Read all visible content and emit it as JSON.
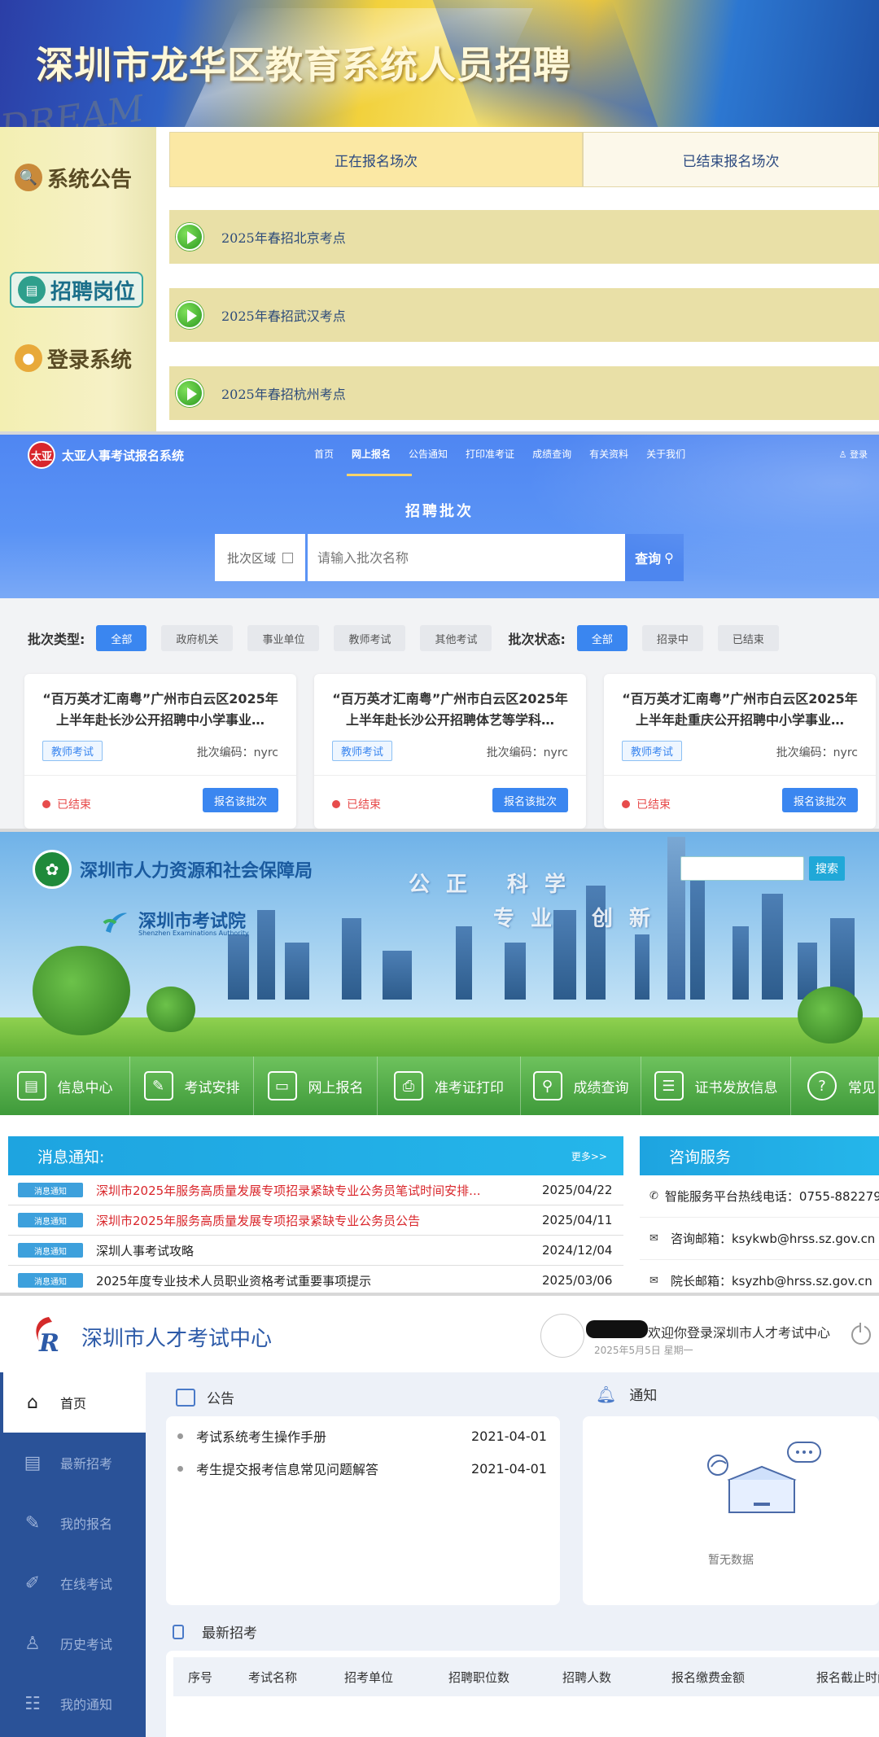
{
  "panel1": {
    "banner_title": "深圳市龙华区教育系统人员招聘",
    "watermark": "DREAM",
    "side": [
      {
        "label": "系统公告",
        "icon": "magnifier-icon"
      },
      {
        "label": "招聘岗位",
        "icon": "chat-icon"
      },
      {
        "label": "登录系统",
        "icon": "user-icon"
      }
    ],
    "tabs": {
      "active": "正在报名场次",
      "inactive": "已结束报名场次"
    },
    "sessions": [
      "2025年春招北京考点",
      "2025年春招武汉考点",
      "2025年春招杭州考点"
    ]
  },
  "panel2": {
    "logo_text": "太亚",
    "system_name": "太亚人事考试报名系统",
    "nav": [
      "首页",
      "网上报名",
      "公告通知",
      "打印准考证",
      "成绩查询",
      "有关资料",
      "关于我们"
    ],
    "nav_active": "网上报名",
    "login": "登录",
    "hero_title": "招聘批次",
    "zone_label": "批次区域",
    "search_placeholder": "请输入批次名称",
    "search_button": "查询",
    "type_label": "批次类型:",
    "types": [
      "全部",
      "政府机关",
      "事业单位",
      "教师考试",
      "其他考试"
    ],
    "status_label": "批次状态:",
    "statuses": [
      "全部",
      "招录中",
      "已结束"
    ],
    "cards": [
      {
        "title": "“百万英才汇南粤”广州市白云区2025年上半年赴长沙公开招聘中小学事业…",
        "tag": "教师考试",
        "code": "批次编码：nyrc",
        "status": "已结束",
        "button": "报名该批次"
      },
      {
        "title": "“百万英才汇南粤”广州市白云区2025年上半年赴长沙公开招聘体艺等学科…",
        "tag": "教师考试",
        "code": "批次编码：nyrc",
        "status": "已结束",
        "button": "报名该批次"
      },
      {
        "title": "“百万英才汇南粤”广州市白云区2025年上半年赴重庆公开招聘中小学事业…",
        "tag": "教师考试",
        "code": "批次编码：nyrc",
        "status": "已结束",
        "button": "报名该批次"
      }
    ]
  },
  "panel3": {
    "bureau": "深圳市人力资源和社会保障局",
    "exam_name": "深圳市考试院",
    "exam_en": "Shenzhen Examinations Authority",
    "slogan1": "公正 科学",
    "slogan2": "专业 创新",
    "search_button": "搜索",
    "menu": [
      {
        "label": "信息中心",
        "icon": "document-icon"
      },
      {
        "label": "考试安排",
        "icon": "pen-icon"
      },
      {
        "label": "网上报名",
        "icon": "monitor-icon"
      },
      {
        "label": "准考证打印",
        "icon": "printer-icon"
      },
      {
        "label": "成绩查询",
        "icon": "search-icon"
      },
      {
        "label": "证书发放信息",
        "icon": "list-icon"
      },
      {
        "label": "常见",
        "icon": "question-icon"
      }
    ],
    "notice_title": "消息通知:",
    "notice_more": "更多>>",
    "notices": [
      {
        "badge": "消息通知",
        "text": "深圳市2025年服务高质量发展专项招录紧缺专业公务员笔试时间安排...",
        "date": "2025/04/22",
        "red": true
      },
      {
        "badge": "消息通知",
        "text": "深圳市2025年服务高质量发展专项招录紧缺专业公务员公告",
        "date": "2025/04/11",
        "red": true
      },
      {
        "badge": "消息通知",
        "text": "深圳人事考试攻略",
        "date": "2024/12/04",
        "red": false
      },
      {
        "badge": "消息通知",
        "text": "2025年度专业技术人员职业资格考试重要事项提示",
        "date": "2025/03/06",
        "red": false
      }
    ],
    "consult_title": "咨询服务",
    "consult": [
      {
        "icon": "phone-icon",
        "text": "智能服务平台热线电话：0755-882279"
      },
      {
        "icon": "mail-icon",
        "text": "咨询邮箱：ksykwb@hrss.sz.gov.cn"
      },
      {
        "icon": "mail-icon",
        "text": "院长邮箱：ksyzhb@hrss.sz.gov.cn"
      }
    ]
  },
  "panel4": {
    "system_name": "深圳市人才考试中心",
    "welcome": "欢迎你登录深圳市人才考试中心",
    "date": "2025年5月5日 星期一",
    "sidebar": [
      {
        "label": "首页",
        "icon": "home-icon"
      },
      {
        "label": "最新招考",
        "icon": "document-icon"
      },
      {
        "label": "我的报名",
        "icon": "user-edit-icon"
      },
      {
        "label": "在线考试",
        "icon": "exam-icon"
      },
      {
        "label": "历史考试",
        "icon": "user-icon"
      },
      {
        "label": "我的通知",
        "icon": "notice-icon"
      }
    ],
    "announce_title": "公告",
    "announcements": [
      {
        "text": "考试系统考生操作手册",
        "date": "2021-04-01"
      },
      {
        "text": "考生提交报考信息常见问题解答",
        "date": "2021-04-01"
      }
    ],
    "notify_title": "通知",
    "empty_text": "暂无数据",
    "latest_title": "最新招考",
    "columns": [
      "序号",
      "考试名称",
      "招考单位",
      "招聘职位数",
      "招聘人数",
      "报名缴费金额",
      "报名截止时间"
    ]
  }
}
